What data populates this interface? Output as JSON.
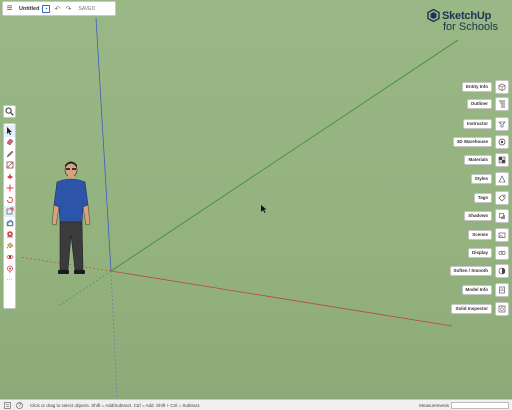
{
  "topbar": {
    "title": "Untitled",
    "saved_label": "SAVED"
  },
  "logo": {
    "brand": "SketchUp",
    "subtitle": "for Schools"
  },
  "left_toolbar": {
    "tools": [
      "select-icon",
      "eraser-icon",
      "pencil-icon",
      "rectangle-icon",
      "push-pull-icon",
      "move-icon",
      "rotate-icon",
      "scale-icon",
      "offset-icon",
      "tape-measure-icon",
      "paint-bucket-icon",
      "orbit-icon",
      "position-camera-icon",
      "more-icon"
    ]
  },
  "right_panel": {
    "items": [
      {
        "label": "Entity Info",
        "icon": "entity-info-icon"
      },
      {
        "label": "Outliner",
        "icon": "outliner-icon"
      },
      {
        "label": "Instructor",
        "icon": "instructor-icon"
      },
      {
        "label": "3D Warehouse",
        "icon": "warehouse-icon"
      },
      {
        "label": "Materials",
        "icon": "materials-icon"
      },
      {
        "label": "Styles",
        "icon": "styles-icon"
      },
      {
        "label": "Tags",
        "icon": "tags-icon"
      },
      {
        "label": "Shadows",
        "icon": "shadows-icon"
      },
      {
        "label": "Scenes",
        "icon": "scenes-icon"
      },
      {
        "label": "Display",
        "icon": "display-icon"
      },
      {
        "label": "Soften / Smooth",
        "icon": "soften-icon"
      },
      {
        "label": "Model Info",
        "icon": "model-info-icon"
      },
      {
        "label": "Solid Inspector",
        "icon": "solid-inspector-icon"
      }
    ]
  },
  "statusbar": {
    "hint": "Click or drag to select objects. Shift = Add/Subtract. Ctrl = Add. Shift + Ctrl = Subtract.",
    "measurements_label": "Measurements",
    "measurements_value": ""
  },
  "colors": {
    "background": "#93b27e",
    "red_axis": "#b84a3a",
    "green_axis": "#3f8f3c",
    "blue_axis": "#3f5fc0",
    "accent": "#2a6cc9"
  }
}
